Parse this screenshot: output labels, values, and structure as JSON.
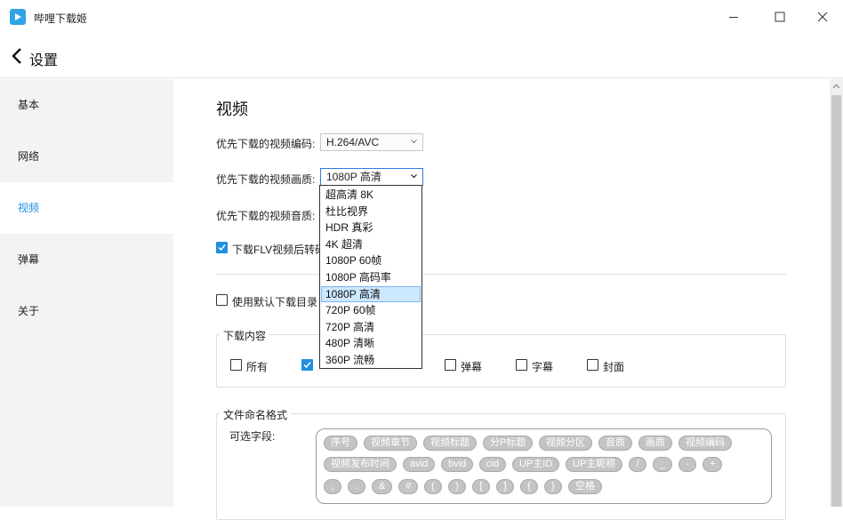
{
  "window": {
    "title": "哔哩下载姬"
  },
  "header": {
    "title": "设置"
  },
  "sidebar": {
    "items": [
      {
        "label": "基本"
      },
      {
        "label": "网络"
      },
      {
        "label": "视频"
      },
      {
        "label": "弹幕"
      },
      {
        "label": "关于"
      }
    ],
    "active_index": 2
  },
  "video": {
    "title": "视频",
    "codec": {
      "label": "优先下载的视频编码:",
      "value": "H.264/AVC"
    },
    "quality": {
      "label": "优先下载的视频画质:",
      "value": "1080P 高清"
    },
    "audio": {
      "label": "优先下载的视频音质:"
    },
    "flv_convert": {
      "label": "下载FLV视频后转码",
      "checked": true
    },
    "default_dir": {
      "label": "使用默认下载目录",
      "checked": false
    },
    "download_content": {
      "legend": "下载内容",
      "options": [
        {
          "label": "所有",
          "checked": false
        },
        {
          "label": "",
          "checked": true
        },
        {
          "label": "弹幕",
          "checked": false
        },
        {
          "label": "字幕",
          "checked": false
        },
        {
          "label": "封面",
          "checked": false
        }
      ]
    },
    "file_naming": {
      "legend": "文件命名格式",
      "fields_label": "可选字段:",
      "tags_row1": [
        "序号",
        "视频章节",
        "视频标题",
        "分P标题",
        "视频分区",
        "音质",
        "画质",
        "视频编码"
      ],
      "tags_row2": [
        "视频发布时间",
        "avid",
        "bvid",
        "cid",
        "UP主ID",
        "UP主昵称",
        "/",
        "_",
        "-",
        "+"
      ],
      "tags_row3": [
        ",",
        ".",
        "&",
        "#",
        "(",
        ")",
        "[",
        "]",
        "{",
        "}",
        "空格"
      ]
    }
  },
  "quality_dropdown": {
    "options": [
      "超高清 8K",
      "杜比视界",
      "HDR 真彩",
      "4K 超清",
      "1080P 60帧",
      "1080P 高码率",
      "1080P 高清",
      "720P 60帧",
      "720P 高清",
      "480P 清晰",
      "360P 流畅"
    ],
    "selected_index": 6
  },
  "colors": {
    "accent": "#1e8fe1",
    "logo": "#2fa3e6",
    "tag": "#c4c4c4"
  }
}
